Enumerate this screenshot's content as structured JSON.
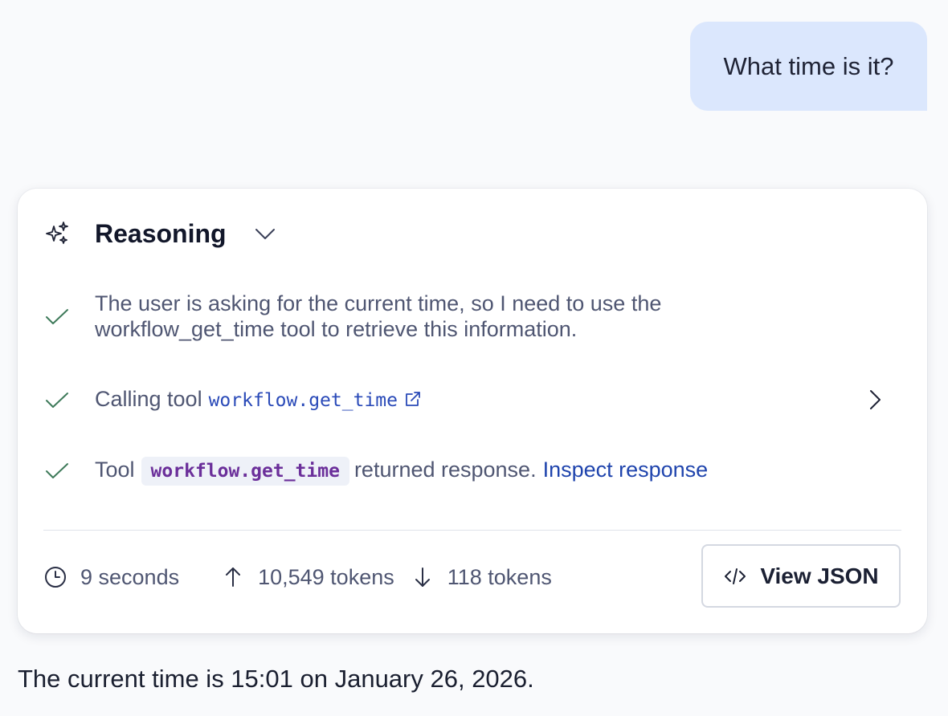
{
  "user_message": "What time is it?",
  "reasoning": {
    "title": "Reasoning",
    "steps": [
      {
        "text": "The user is asking for the current time, so I need to use the workflow_get_time tool to retrieve this information."
      },
      {
        "prefix": "Calling tool",
        "tool_name": "workflow.get_time"
      },
      {
        "prefix": "Tool",
        "tool_name": "workflow.get_time",
        "suffix": "returned response.",
        "link": "Inspect response"
      }
    ],
    "footer": {
      "duration": "9 seconds",
      "input_tokens": "10,549 tokens",
      "output_tokens": "118 tokens",
      "view_json_label": "View JSON"
    }
  },
  "assistant_message": "The current time is 15:01 on January 26, 2026.",
  "colors": {
    "user_bubble": "#dbe7fd",
    "check": "#3e7a5a",
    "link": "#2a4ab8",
    "chip_text": "#6b2f9a"
  }
}
